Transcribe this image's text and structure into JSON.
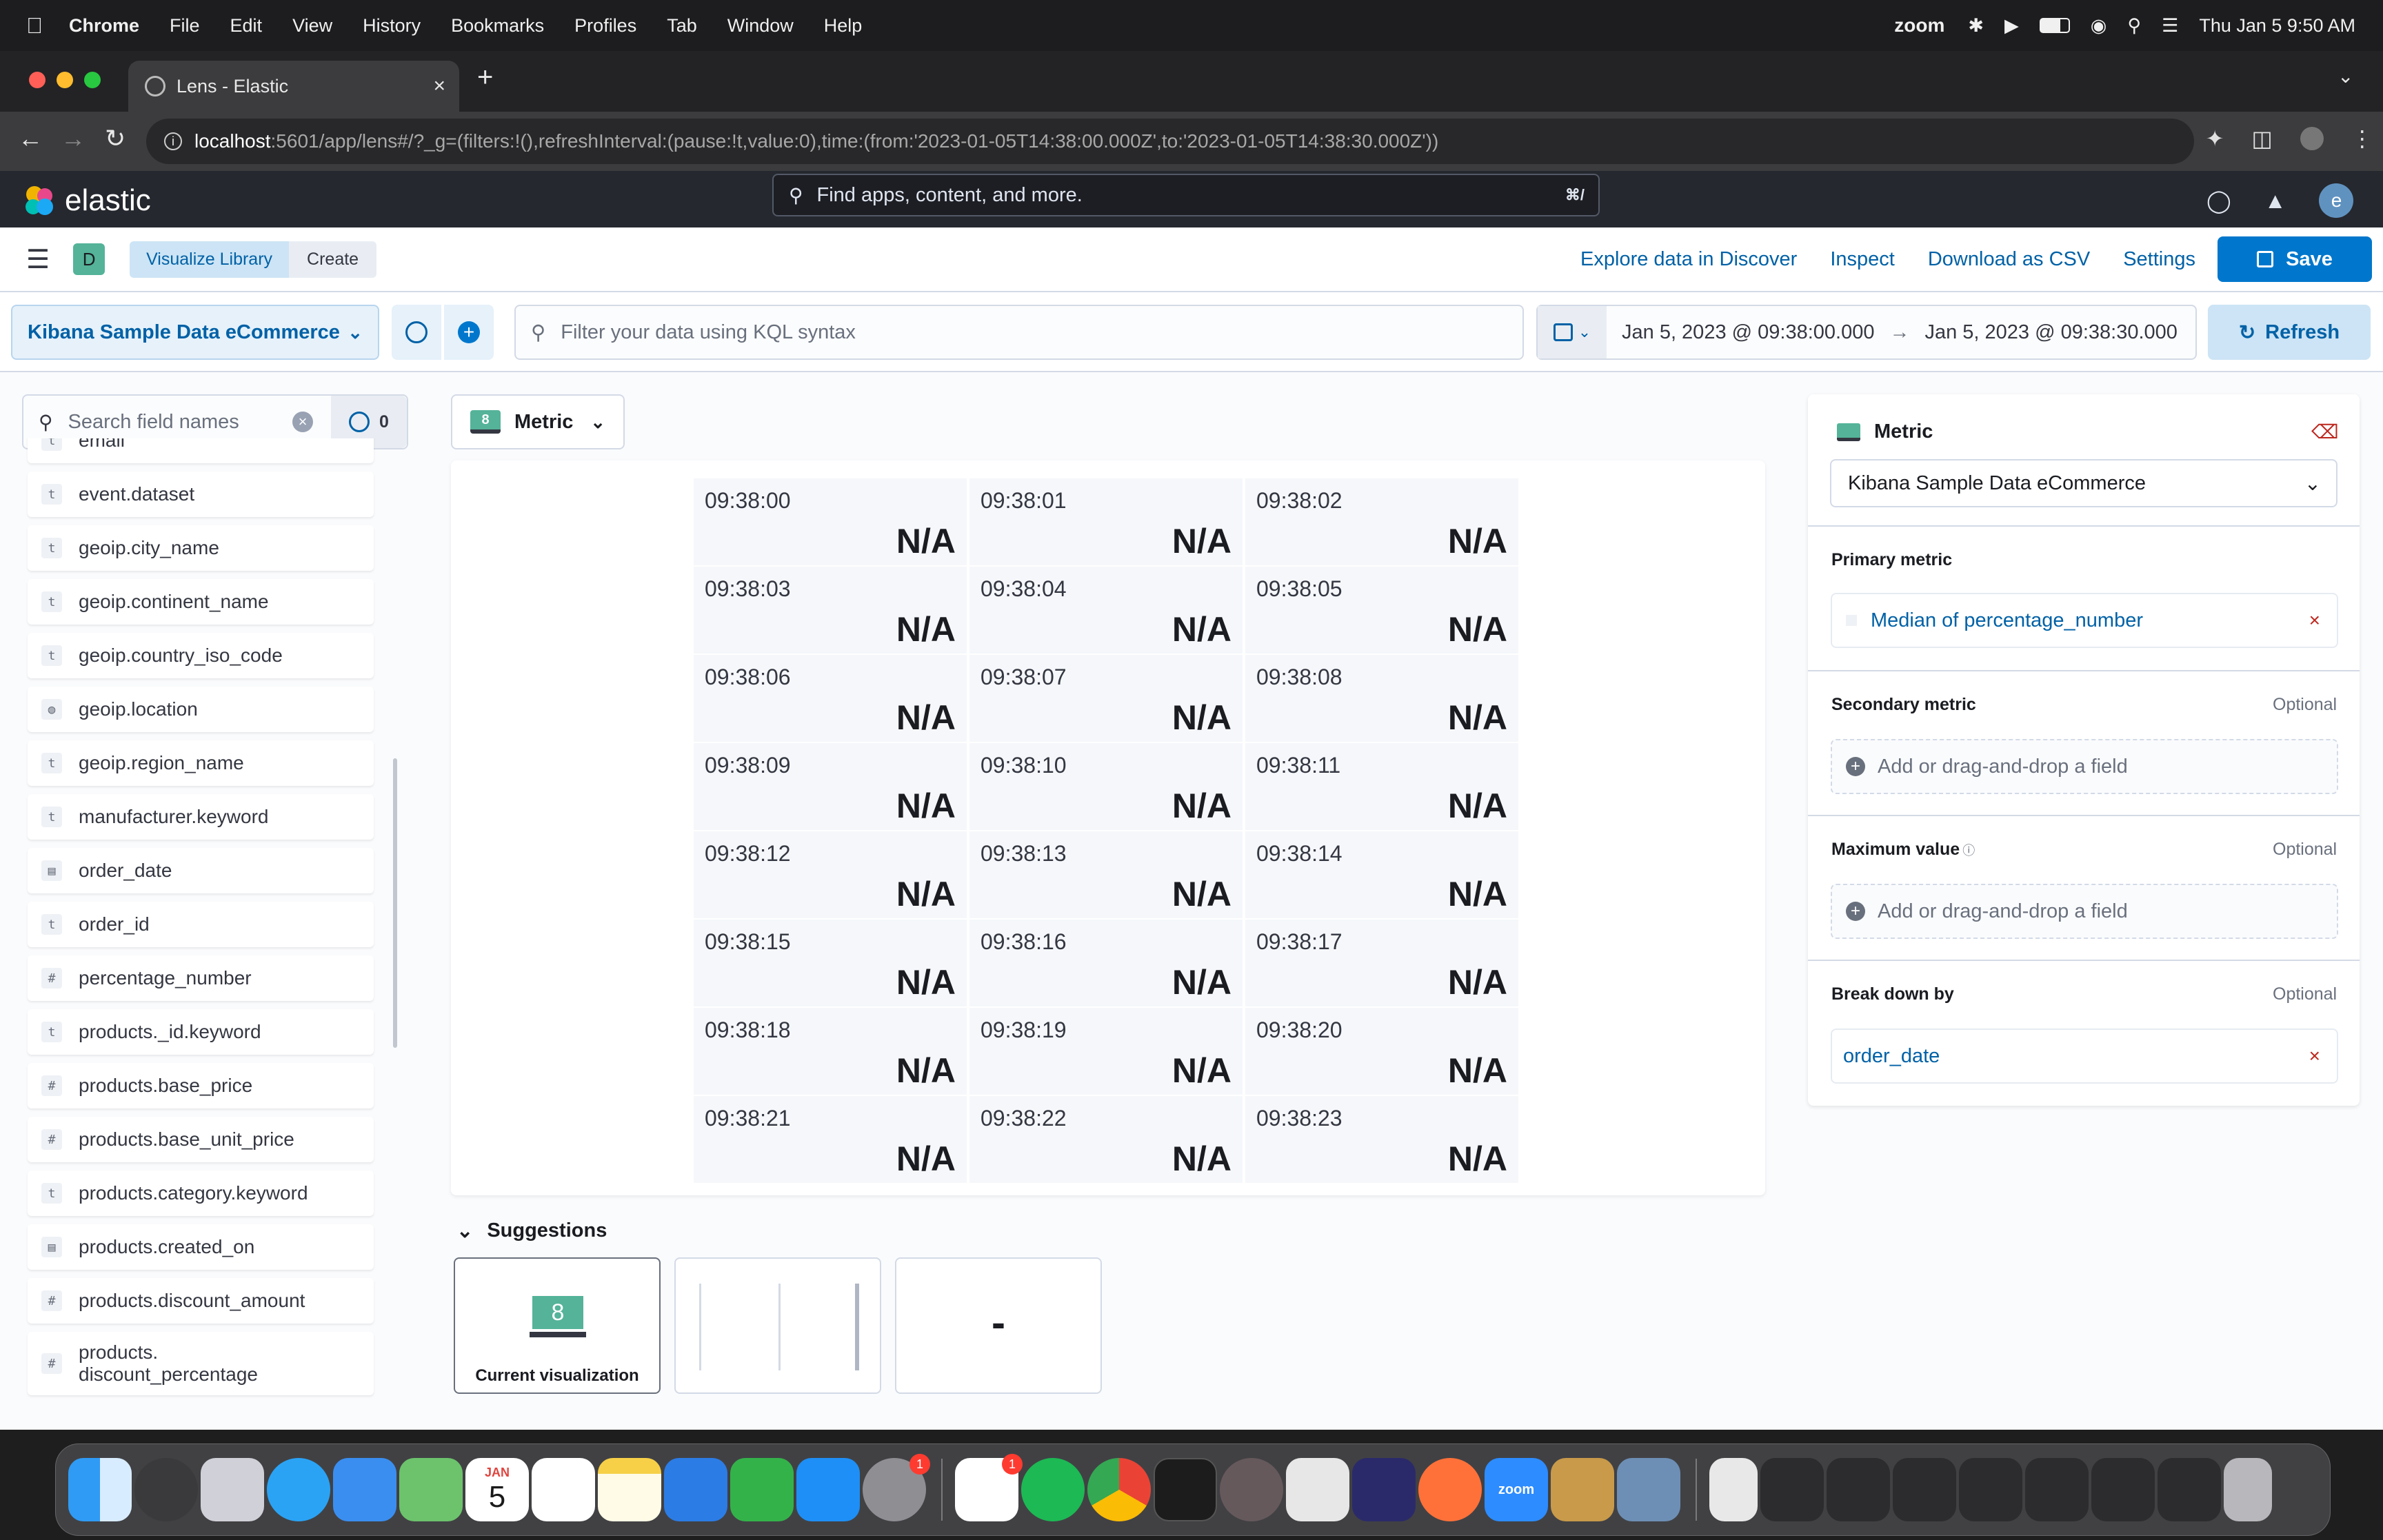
{
  "menubar": {
    "app": "Chrome",
    "items": [
      "File",
      "Edit",
      "View",
      "History",
      "Bookmarks",
      "Profiles",
      "Tab",
      "Window",
      "Help"
    ],
    "zoom_label": "zoom",
    "datetime": "Thu Jan 5  9:50 AM"
  },
  "browser": {
    "tab_title": "Lens - Elastic",
    "url_host": "localhost",
    "url_rest": ":5601/app/lens#/?_g=(filters:!(),refreshInterval:(pause:!t,value:0),time:(from:'2023-01-05T14:38:00.000Z',to:'2023-01-05T14:38:30.000Z'))"
  },
  "header": {
    "logo_text": "elastic",
    "search_placeholder": "Find apps, content, and more.",
    "search_shortcut": "⌘/",
    "user_initial": "e"
  },
  "appbar": {
    "space_initial": "D",
    "breadcrumb": [
      "Visualize Library",
      "Create"
    ],
    "actions": [
      "Explore data in Discover",
      "Inspect",
      "Download as CSV",
      "Settings"
    ],
    "save_label": "Save"
  },
  "querybar": {
    "dataview": "Kibana Sample Data eCommerce",
    "kql_placeholder": "Filter your data using KQL syntax",
    "time_from": "Jan 5, 2023 @ 09:38:00.000",
    "time_to": "Jan 5, 2023 @ 09:38:30.000",
    "refresh_label": "Refresh"
  },
  "fieldlist": {
    "search_placeholder": "Search field names",
    "filter_count": "0",
    "fields": [
      {
        "type": "t",
        "name": "email"
      },
      {
        "type": "t",
        "name": "event.dataset"
      },
      {
        "type": "t",
        "name": "geoip.city_name"
      },
      {
        "type": "t",
        "name": "geoip.continent_name"
      },
      {
        "type": "t",
        "name": "geoip.country_iso_code"
      },
      {
        "type": "geo",
        "name": "geoip.location"
      },
      {
        "type": "t",
        "name": "geoip.region_name"
      },
      {
        "type": "t",
        "name": "manufacturer.keyword"
      },
      {
        "type": "date",
        "name": "order_date"
      },
      {
        "type": "t",
        "name": "order_id"
      },
      {
        "type": "#",
        "name": "percentage_number"
      },
      {
        "type": "t",
        "name": "products._id.keyword"
      },
      {
        "type": "#",
        "name": "products.base_price"
      },
      {
        "type": "#",
        "name": "products.base_unit_price"
      },
      {
        "type": "t",
        "name": "products.category.keyword"
      },
      {
        "type": "date",
        "name": "products.created_on"
      },
      {
        "type": "#",
        "name": "products.discount_amount"
      },
      {
        "type": "#",
        "name": "products.\ndiscount_percentage"
      }
    ]
  },
  "workspace": {
    "chart_type_label": "Metric",
    "metrics": [
      {
        "t": "09:38:00",
        "v": "N/A"
      },
      {
        "t": "09:38:01",
        "v": "N/A"
      },
      {
        "t": "09:38:02",
        "v": "N/A"
      },
      {
        "t": "09:38:03",
        "v": "N/A"
      },
      {
        "t": "09:38:04",
        "v": "N/A"
      },
      {
        "t": "09:38:05",
        "v": "N/A"
      },
      {
        "t": "09:38:06",
        "v": "N/A"
      },
      {
        "t": "09:38:07",
        "v": "N/A"
      },
      {
        "t": "09:38:08",
        "v": "N/A"
      },
      {
        "t": "09:38:09",
        "v": "N/A"
      },
      {
        "t": "09:38:10",
        "v": "N/A"
      },
      {
        "t": "09:38:11",
        "v": "N/A"
      },
      {
        "t": "09:38:12",
        "v": "N/A"
      },
      {
        "t": "09:38:13",
        "v": "N/A"
      },
      {
        "t": "09:38:14",
        "v": "N/A"
      },
      {
        "t": "09:38:15",
        "v": "N/A"
      },
      {
        "t": "09:38:16",
        "v": "N/A"
      },
      {
        "t": "09:38:17",
        "v": "N/A"
      },
      {
        "t": "09:38:18",
        "v": "N/A"
      },
      {
        "t": "09:38:19",
        "v": "N/A"
      },
      {
        "t": "09:38:20",
        "v": "N/A"
      },
      {
        "t": "09:38:21",
        "v": "N/A"
      },
      {
        "t": "09:38:22",
        "v": "N/A"
      },
      {
        "t": "09:38:23",
        "v": "N/A"
      }
    ],
    "suggestions_title": "Suggestions",
    "suggestion_current": "Current visualization",
    "metric_glyph": "8",
    "suggestion_dash": "-"
  },
  "config": {
    "title": "Metric",
    "dataview": "Kibana Sample Data eCommerce",
    "primary_label": "Primary metric",
    "primary_value": "Median of percentage_number",
    "secondary_label": "Secondary metric",
    "secondary_placeholder": "Add or drag-and-drop a field",
    "max_label": "Maximum value",
    "max_placeholder": "Add or drag-and-drop a field",
    "breakdown_label": "Break down by",
    "breakdown_value": "order_date",
    "optional": "Optional"
  },
  "dock": {
    "calendar_month": "JAN",
    "calendar_day": "5",
    "zoom": "zoom",
    "badge_settings": "1",
    "badge_slack": "1"
  },
  "colors": {
    "primary": "#0077cc",
    "link": "#0061a6",
    "metric_icon": "#54b399",
    "danger": "#bd271e"
  }
}
